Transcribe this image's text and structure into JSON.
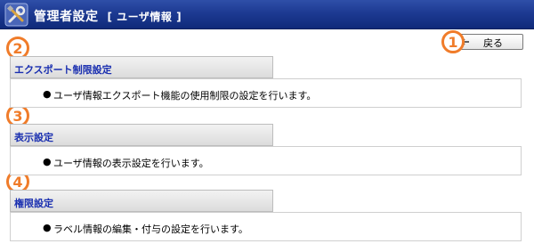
{
  "header": {
    "title": "管理者設定",
    "subtitle": "[ ユーザ情報 ]",
    "icon": "tools-icon"
  },
  "toolbar": {
    "back_label": "戻る",
    "back_icon": "back-arrow-icon"
  },
  "callouts": [
    "1",
    "2",
    "3",
    "4"
  ],
  "sections": [
    {
      "label": "エクスポート制限設定",
      "description": "ユーザ情報エクスポート機能の使用制限の設定を行います。"
    },
    {
      "label": "表示設定",
      "description": "ユーザ情報の表示設定を行います。"
    },
    {
      "label": "権限設定",
      "description": "ラベル情報の編集・付与の設定を行います。"
    }
  ],
  "bullet": "●",
  "colors": {
    "titlebar": "#1d3a92",
    "callout": "#f07c2a",
    "section_label": "#1a2fb0"
  }
}
